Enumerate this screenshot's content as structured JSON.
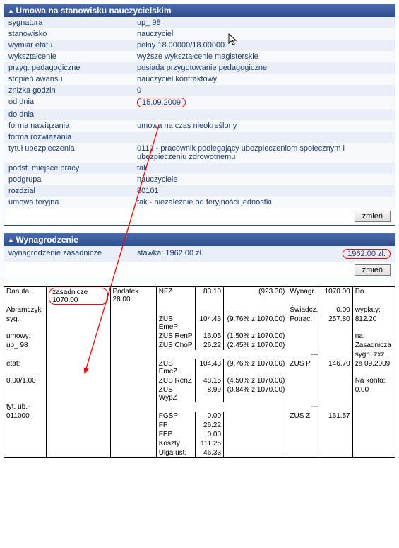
{
  "umowa": {
    "header": "Umowa na stanowisku nauczycielskim",
    "rows": [
      {
        "k": "sygnatura",
        "v": "up_ 98"
      },
      {
        "k": "stanowisko",
        "v": "nauczyciel"
      },
      {
        "k": "wymiar etatu",
        "v": "pełny 18.00000/18.00000"
      },
      {
        "k": "wykształcenie",
        "v": "wyższe wykształcenie magisterskie"
      },
      {
        "k": "przyg. pedagogiczne",
        "v": "posiada przygotowanie pedagogiczne"
      },
      {
        "k": "stopień awansu",
        "v": "nauczyciel kontraktowy"
      },
      {
        "k": "zniżka godzin",
        "v": "0"
      },
      {
        "k": "od dnia",
        "v": "15.09.2009",
        "circled": true
      },
      {
        "k": "do dnia",
        "v": ""
      },
      {
        "k": "forma nawiązania",
        "v": "umowa na czas nieokreślony"
      },
      {
        "k": "forma rozwiązania",
        "v": ""
      },
      {
        "k": "tytuł ubezpieczenia",
        "v": "0110 - pracownik podlegający ubezpieczeniom społecznym i ubezpieczeniu zdrowotnemu"
      },
      {
        "k": "podst. miejsce pracy",
        "v": "tak"
      },
      {
        "k": "podgrupa",
        "v": "nauczyciele"
      },
      {
        "k": "rozdział",
        "v": "80101"
      },
      {
        "k": "umowa feryjna",
        "v": "tak - niezależnie od feryjności jednostki"
      }
    ],
    "button": "zmień"
  },
  "wynagrodzenie": {
    "header": "Wynagrodzenie",
    "key": "wynagrodzenie zasadnicze",
    "stawka": "stawka: 1962.00 zł.",
    "value": "1962.00 zł.",
    "button": "zmień"
  },
  "calc": {
    "name_lines": [
      "Danuta",
      "Abramczyk",
      "syg.",
      "umowy:",
      "up_ 98",
      "",
      "etat:",
      "0.00/1.00",
      "",
      "tyt. ub.-",
      "011000"
    ],
    "zasadnicze_label": "zasadnicze 1070.00",
    "podatek": {
      "label": "Podatek",
      "val": "28.00"
    },
    "nfz": {
      "label": "NFZ",
      "val": "83.10",
      "paren": "(923.30)"
    },
    "zus_items": [
      {
        "label": "ZUS EmeP",
        "val": "104.43",
        "paren": "(9.76% z 1070.00)"
      },
      {
        "label": "ZUS RenP",
        "val": "16.05",
        "paren": "(1.50% z 1070.00)"
      },
      {
        "label": "ZUS ChoP",
        "val": "26.22",
        "paren": "(2.45% z 1070.00)"
      }
    ],
    "zus_items2": [
      {
        "label": "ZUS EmeZ",
        "val": "104.43",
        "paren": "(9.76% z 1070.00)"
      },
      {
        "label": "ZUS RenZ",
        "val": "48.15",
        "paren": "(4.50% z 1070.00)"
      },
      {
        "label": "ZUS WypZ",
        "val": "8.99",
        "paren": "(0.84% z 1070.00)"
      }
    ],
    "bottom_items": [
      {
        "label": "FGŚP",
        "val": "0.00"
      },
      {
        "label": "FP",
        "val": "26.22"
      },
      {
        "label": "FEP",
        "val": "0.00"
      },
      {
        "label": "Koszty",
        "val": "111.25"
      },
      {
        "label": "Ulga ust.",
        "val": "46.33"
      }
    ],
    "right1": [
      {
        "label": "Wynagr.",
        "val": "1070.00"
      },
      {
        "label": "Świadcz.",
        "val": "0.00"
      },
      {
        "label": "Potrąc.",
        "val": "257.80"
      }
    ],
    "zus_p": {
      "label": "ZUS P",
      "val": "146.70"
    },
    "zus_z": {
      "label": "ZUS Z",
      "val": "161.57"
    },
    "doWyp": {
      "lines": [
        "Do",
        "wypłaty:",
        "812.20",
        "na:",
        "Zasadnicza",
        "sygn: zxz",
        "za 09.2009",
        "Na konto:",
        "0.00"
      ]
    }
  }
}
